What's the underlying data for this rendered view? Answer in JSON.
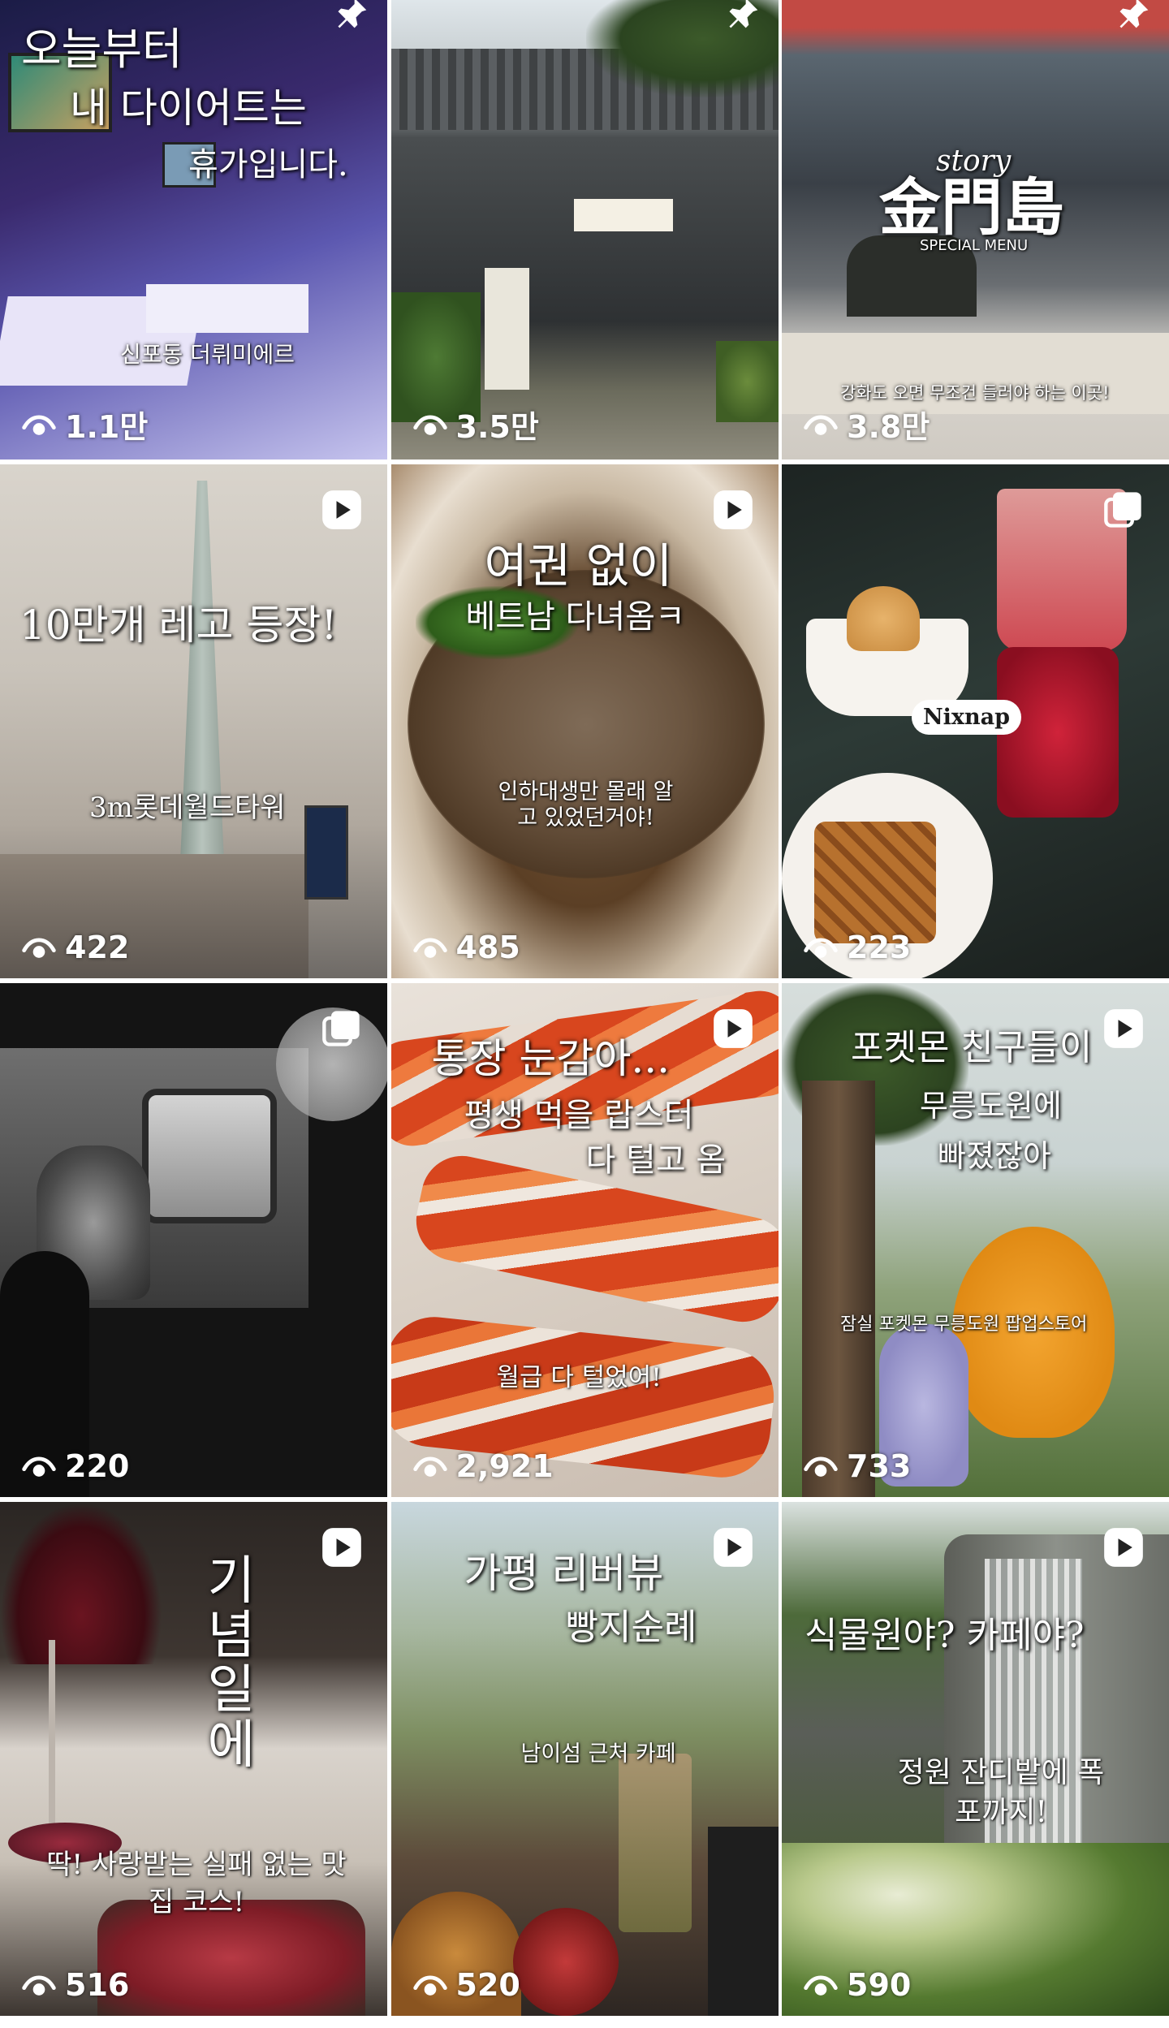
{
  "tiles": [
    {
      "caption": [
        "오늘부터",
        "내 다이어트는",
        "휴가입니다."
      ],
      "subcaption": "신포동 더뤼미에르",
      "views": "1.1만",
      "badge": "pin-icon"
    },
    {
      "caption": [],
      "subcaption": "",
      "views": "3.5만",
      "badge": "pin-icon"
    },
    {
      "caption": [
        "story",
        "金門島",
        "SPECIAL MENU"
      ],
      "subcaption": "강화도 오면 무조건 들러야 하는 이곳!",
      "views": "3.8만",
      "badge": "pin-icon"
    },
    {
      "caption": [
        "10만개 레고 등장!"
      ],
      "subcaption": "3m롯데월드타워",
      "views": "422",
      "badge": "reel-icon"
    },
    {
      "caption": [
        "여권 없이",
        "베트남 다녀옴ㅋ"
      ],
      "subcaption": "인하대생만 몰래 알고 있었던거야!",
      "views": "485",
      "badge": "reel-icon"
    },
    {
      "caption": [
        "Nixnap"
      ],
      "subcaption": "",
      "views": "223",
      "badge": "carousel-icon"
    },
    {
      "caption": [],
      "subcaption": "",
      "views": "220",
      "badge": "carousel-icon"
    },
    {
      "caption": [
        "통장 눈감아...",
        "평생 먹을 랍스터",
        "다 털고 옴"
      ],
      "subcaption": "월급 다 털었어!",
      "views": "2,921",
      "badge": "reel-icon"
    },
    {
      "caption": [
        "포켓몬 친구들이",
        "무릉도원에",
        "빠졌잖아"
      ],
      "subcaption": "잠실 포켓몬 무릉도원 팝업스토어",
      "views": "733",
      "badge": "reel-icon"
    },
    {
      "caption": [
        "기념일에"
      ],
      "subcaption": "딱! 사랑받는 실패 없는 맛집 코스!",
      "views": "516",
      "badge": "reel-icon"
    },
    {
      "caption": [
        "가평 리버뷰",
        "빵지순례"
      ],
      "subcaption": "남이섬 근처 카페",
      "views": "520",
      "badge": "reel-icon"
    },
    {
      "caption": [
        "식물원야? 카페야?"
      ],
      "subcaption": "정원 잔디밭에 폭포까지!",
      "views": "590",
      "badge": "reel-icon"
    }
  ],
  "colors": {
    "overlay_text": "#ffffff",
    "background": "#ffffff"
  }
}
